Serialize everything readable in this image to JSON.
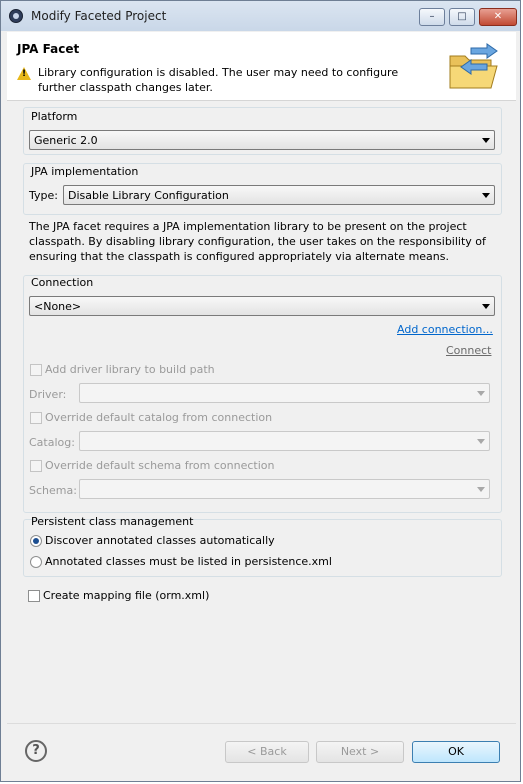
{
  "window": {
    "title": "Modify Faceted Project"
  },
  "header": {
    "title": "JPA Facet",
    "message": "Library configuration is disabled. The user may need to configure further classpath changes later."
  },
  "platform": {
    "label": "Platform",
    "value": "Generic 2.0"
  },
  "jpa_impl": {
    "label": "JPA implementation",
    "type_label": "Type:",
    "type_value": "Disable Library Configuration",
    "description": "The JPA facet requires a JPA implementation library to be present on the project classpath. By disabling library configuration, the user takes on the responsibility of ensuring that the classpath is configured appropriately via alternate means."
  },
  "connection": {
    "label": "Connection",
    "value": "<None>",
    "add_connection": "Add connection...",
    "connect": "Connect",
    "add_driver": "Add driver library to build path",
    "driver_label": "Driver:",
    "override_catalog": "Override default catalog from connection",
    "catalog_label": "Catalog:",
    "override_schema": "Override default schema from connection",
    "schema_label": "Schema:"
  },
  "persistent": {
    "label": "Persistent class management",
    "option1": "Discover annotated classes automatically",
    "option2": "Annotated classes must be listed in persistence.xml",
    "selected": "option1"
  },
  "mapping": {
    "label": "Create mapping file (orm.xml)",
    "checked": false
  },
  "footer": {
    "help": "?",
    "back": "< Back",
    "next": "Next >",
    "ok": "OK"
  },
  "icons": {
    "app": "eclipse-icon",
    "warning": "warning-icon",
    "banner": "folder-sync-icon",
    "help": "help-icon"
  }
}
